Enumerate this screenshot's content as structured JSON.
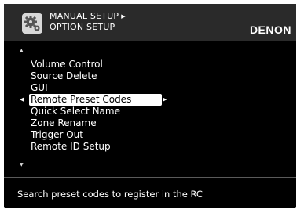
{
  "header": {
    "line1": "MANUAL SETUP",
    "line1_arrow": "▶",
    "line2": "OPTION SETUP",
    "brand": "DENON",
    "icon": "gear-icon"
  },
  "menu": {
    "scroll_up": "▲",
    "scroll_down": "▼",
    "items": [
      {
        "label": "Volume Control"
      },
      {
        "label": "Source Delete"
      },
      {
        "label": "GUI"
      },
      {
        "label": "Remote Preset Codes"
      },
      {
        "label": "Quick Select Name"
      },
      {
        "label": "Zone Rename"
      },
      {
        "label": "Trigger Out"
      },
      {
        "label": "Remote ID Setup"
      }
    ],
    "selected_index": 3,
    "left_arrow": "◀",
    "right_arrow": "▶"
  },
  "footer": {
    "hint": "Search preset codes to register in the RC"
  },
  "colors": {
    "background": "#000000",
    "header": "#2a2a2a",
    "text": "#ffffff",
    "highlight": "#ffffff"
  }
}
